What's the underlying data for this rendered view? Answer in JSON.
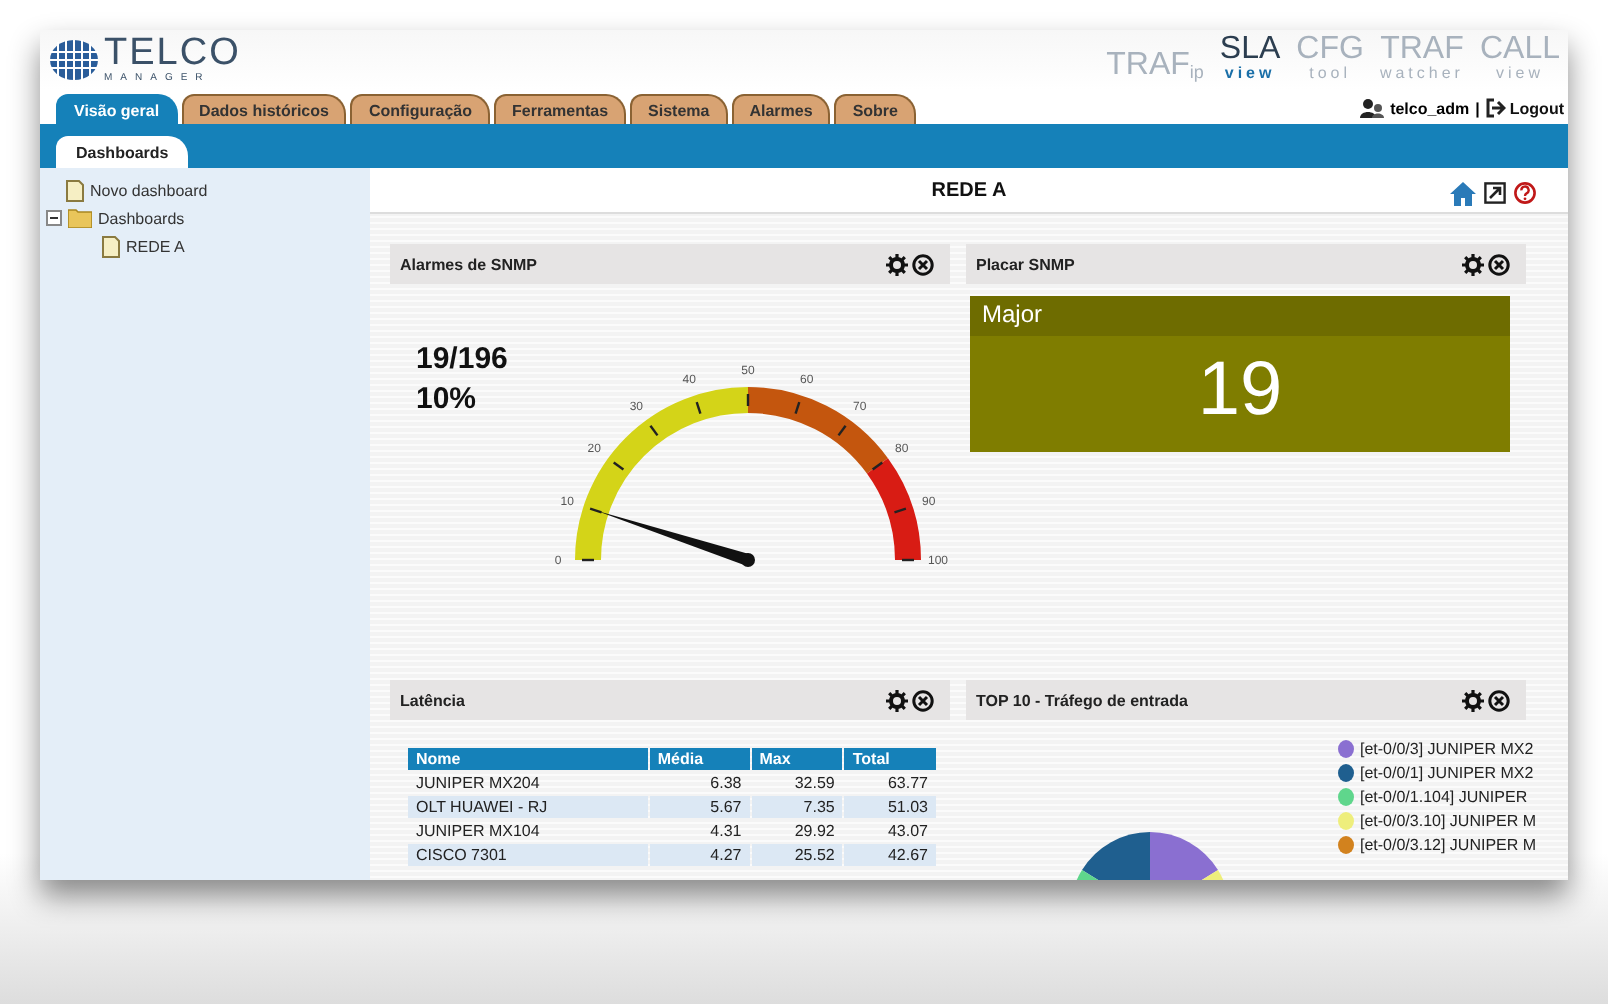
{
  "logo": {
    "title": "TELCO",
    "subtitle": "MANAGER"
  },
  "products": [
    {
      "name": "TRAF",
      "sub": "ip",
      "kind": "sub",
      "selected": false
    },
    {
      "name": "SLA",
      "sub": "view",
      "kind": "under",
      "selected": true
    },
    {
      "name": "CFG",
      "sub": "tool",
      "kind": "under",
      "selected": false
    },
    {
      "name": "TRAF",
      "sub": "watcher",
      "kind": "under",
      "selected": false
    },
    {
      "name": "CALL",
      "sub": "view",
      "kind": "under",
      "selected": false
    }
  ],
  "user": {
    "name": "telco_adm",
    "separator": "|",
    "logout": "Logout"
  },
  "tabs": [
    {
      "label": "Visão geral",
      "selected": true
    },
    {
      "label": "Dados históricos",
      "selected": false
    },
    {
      "label": "Configuração",
      "selected": false
    },
    {
      "label": "Ferramentas",
      "selected": false
    },
    {
      "label": "Sistema",
      "selected": false
    },
    {
      "label": "Alarmes",
      "selected": false
    },
    {
      "label": "Sobre",
      "selected": false
    }
  ],
  "subtabs": [
    {
      "label": "Dashboards",
      "selected": true
    }
  ],
  "sidebar": {
    "items": [
      {
        "label": "Novo dashboard",
        "kind": "file"
      },
      {
        "label": "Dashboards",
        "kind": "folder",
        "expanded": true,
        "children": [
          {
            "label": "REDE A",
            "kind": "file"
          }
        ]
      }
    ]
  },
  "page_title": "REDE A",
  "widgets": [
    {
      "title": "Alarmes de SNMP",
      "kind": "gauge",
      "count": "19/196",
      "percent": "10%",
      "level": 0.1,
      "scale_labels": [
        "0",
        "10",
        "20",
        "30",
        "40",
        "50",
        "60",
        "70",
        "80",
        "90",
        "100"
      ]
    },
    {
      "title": "Placar SNMP",
      "kind": "score",
      "label": "Major",
      "value": "19"
    },
    {
      "title": "Latência",
      "kind": "table",
      "columns": [
        "Nome",
        "Média",
        "Max",
        "Total"
      ],
      "rows": [
        [
          "JUNIPER MX204",
          "6.38",
          "32.59",
          "63.77"
        ],
        [
          "OLT HUAWEI - RJ",
          "5.67",
          "7.35",
          "51.03"
        ],
        [
          "JUNIPER MX104",
          "4.31",
          "29.92",
          "43.07"
        ],
        [
          "CISCO 7301",
          "4.27",
          "25.52",
          "42.67"
        ]
      ]
    },
    {
      "title": "TOP 10 - Tráfego de entrada",
      "kind": "pie",
      "legend": [
        {
          "label": "[et-0/0/3] JUNIPER MX2",
          "color": "#8a6fd1"
        },
        {
          "label": "[et-0/0/1] JUNIPER MX2",
          "color": "#1f5f8f"
        },
        {
          "label": "[et-0/0/1.104] JUNIPER",
          "color": "#5fd68c"
        },
        {
          "label": "[et-0/0/3.10] JUNIPER M",
          "color": "#eeee7c"
        },
        {
          "label": "[et-0/0/3.12] JUNIPER M",
          "color": "#d2821e"
        }
      ]
    }
  ]
}
